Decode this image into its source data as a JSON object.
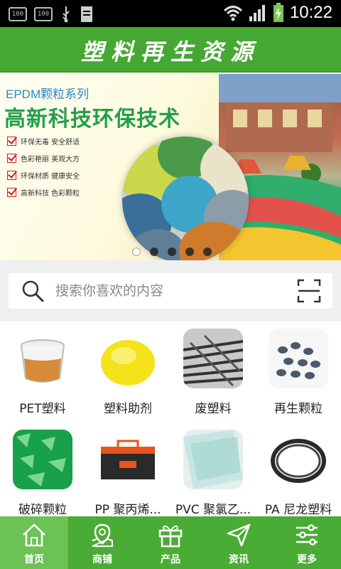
{
  "status_bar": {
    "left_icons": [
      "100",
      "100"
    ],
    "time": "10:22"
  },
  "app": {
    "title": "塑料再生资源"
  },
  "banner": {
    "subtitle": "EPDM颗粒系列",
    "headline": "高新科技环保技术",
    "features": [
      "环保无毒  安全舒适",
      "色彩艳丽  美观大方",
      "环保材质  健康安全",
      "高新科技  色彩颗粒"
    ],
    "slide_count": 5,
    "active_slide": 1
  },
  "search": {
    "placeholder": "搜索你喜欢的内容"
  },
  "categories": [
    {
      "label": "PET塑料",
      "icon": "plastic-cup-image"
    },
    {
      "label": "塑料助剂",
      "icon": "yellow-powder-image"
    },
    {
      "label": "废塑料",
      "icon": "waste-plastic-image"
    },
    {
      "label": "再生颗粒",
      "icon": "recycled-pellets-image"
    },
    {
      "label": "破碎颗粒",
      "icon": "crushed-green-image"
    },
    {
      "label": "PP 聚丙烯...",
      "icon": "toolbox-image"
    },
    {
      "label": "PVC 聚氯乙...",
      "icon": "pvc-sheet-image"
    },
    {
      "label": "PA 尼龙塑料",
      "icon": "nylon-coil-image"
    }
  ],
  "tabs": [
    {
      "label": "首页",
      "icon": "home-icon",
      "active": true
    },
    {
      "label": "商铺",
      "icon": "map-pin-icon",
      "active": false
    },
    {
      "label": "产品",
      "icon": "gift-icon",
      "active": false
    },
    {
      "label": "资讯",
      "icon": "send-icon",
      "active": false
    },
    {
      "label": "更多",
      "icon": "sliders-icon",
      "active": false
    }
  ],
  "colors": {
    "primary_green": "#45a832",
    "tab_active": "#6cc255"
  }
}
